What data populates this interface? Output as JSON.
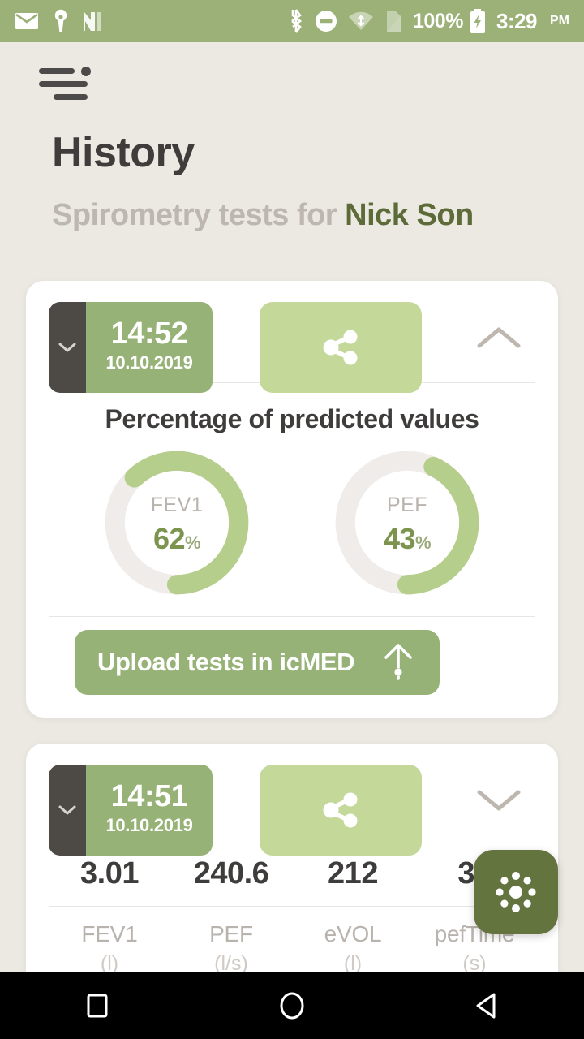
{
  "statusbar": {
    "left_icons": [
      "mail-icon",
      "key-icon",
      "n-app-icon"
    ],
    "right_icons": [
      "bluetooth-icon",
      "do-not-disturb-icon",
      "wifi-icon",
      "sim-card-icon"
    ],
    "battery_percent": "100%",
    "battery_icon": "battery-charging-icon",
    "clock": "3:29",
    "ampm": "PM",
    "bg_color": "#9cb177"
  },
  "toolbar": {
    "menu_icon": "hamburger-menu-icon"
  },
  "header": {
    "title": "History",
    "subtitle_prefix": "Spirometry tests for ",
    "user_name": "Nick Son",
    "user_name_color": "#5c6b38"
  },
  "cards": [
    {
      "time": "14:52",
      "date": "10.10.2019",
      "expanded": true,
      "toggle_icon": "chevron-up-icon",
      "expand_tab_icon": "chevron-down-icon",
      "share_icon": "share-icon",
      "section_title": "Percentage of predicted values",
      "gauges": [
        {
          "label": "FEV1",
          "value": "62",
          "unit": "%",
          "percent": 62
        },
        {
          "label": "PEF",
          "value": "43",
          "unit": "%",
          "percent": 43
        }
      ],
      "upload_label": "Upload tests in icMED",
      "upload_icon": "upload-arrow-icon"
    },
    {
      "time": "14:51",
      "date": "10.10.2019",
      "expanded": false,
      "toggle_icon": "chevron-down-icon",
      "expand_tab_icon": "chevron-down-icon",
      "share_icon": "share-icon",
      "metrics": [
        {
          "value": "3.01",
          "label": "FEV1",
          "unit": "(l)"
        },
        {
          "value": "240.6",
          "label": "PEF",
          "unit": "(l/s)"
        },
        {
          "value": "212",
          "label": "eVOL",
          "unit": "(l)"
        },
        {
          "value": "36",
          "label": "pefTime",
          "unit": "(s)"
        }
      ]
    }
  ],
  "fab": {
    "icon": "loading-dots-icon",
    "color": "#64743f"
  },
  "navbar": {
    "buttons": [
      {
        "name": "recents-button",
        "icon": "square-icon"
      },
      {
        "name": "home-button",
        "icon": "circle-icon"
      },
      {
        "name": "back-button",
        "icon": "triangle-left-icon"
      }
    ]
  },
  "theme": {
    "accent_green": "#96b277",
    "light_green": "#c3d899",
    "gauge_green": "#b5ce8b",
    "gauge_track": "#efecea",
    "page_bg": "#ece9e3",
    "card_bg": "#ffffff",
    "dark_text": "#3f3d3c",
    "muted_text": "#b8b3ac"
  }
}
